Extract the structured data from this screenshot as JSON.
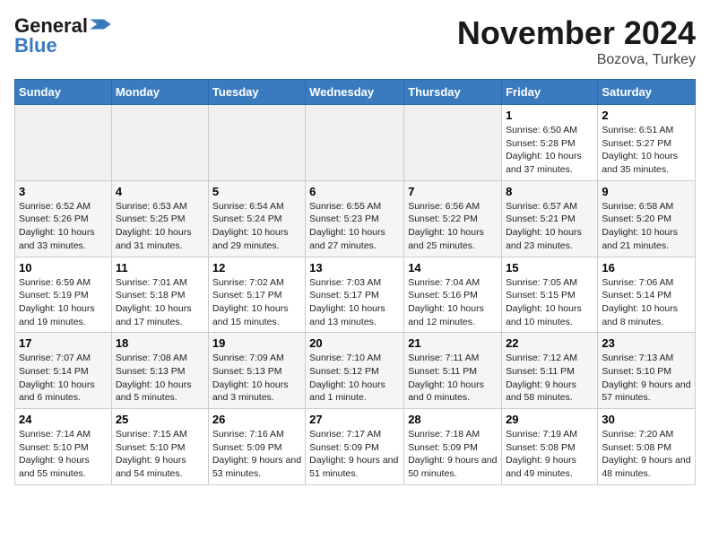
{
  "logo": {
    "line1": "General",
    "line2": "Blue"
  },
  "title": "November 2024",
  "location": "Bozova, Turkey",
  "days_of_week": [
    "Sunday",
    "Monday",
    "Tuesday",
    "Wednesday",
    "Thursday",
    "Friday",
    "Saturday"
  ],
  "weeks": [
    [
      {
        "num": "",
        "info": ""
      },
      {
        "num": "",
        "info": ""
      },
      {
        "num": "",
        "info": ""
      },
      {
        "num": "",
        "info": ""
      },
      {
        "num": "",
        "info": ""
      },
      {
        "num": "1",
        "info": "Sunrise: 6:50 AM\nSunset: 5:28 PM\nDaylight: 10 hours and 37 minutes."
      },
      {
        "num": "2",
        "info": "Sunrise: 6:51 AM\nSunset: 5:27 PM\nDaylight: 10 hours and 35 minutes."
      }
    ],
    [
      {
        "num": "3",
        "info": "Sunrise: 6:52 AM\nSunset: 5:26 PM\nDaylight: 10 hours and 33 minutes."
      },
      {
        "num": "4",
        "info": "Sunrise: 6:53 AM\nSunset: 5:25 PM\nDaylight: 10 hours and 31 minutes."
      },
      {
        "num": "5",
        "info": "Sunrise: 6:54 AM\nSunset: 5:24 PM\nDaylight: 10 hours and 29 minutes."
      },
      {
        "num": "6",
        "info": "Sunrise: 6:55 AM\nSunset: 5:23 PM\nDaylight: 10 hours and 27 minutes."
      },
      {
        "num": "7",
        "info": "Sunrise: 6:56 AM\nSunset: 5:22 PM\nDaylight: 10 hours and 25 minutes."
      },
      {
        "num": "8",
        "info": "Sunrise: 6:57 AM\nSunset: 5:21 PM\nDaylight: 10 hours and 23 minutes."
      },
      {
        "num": "9",
        "info": "Sunrise: 6:58 AM\nSunset: 5:20 PM\nDaylight: 10 hours and 21 minutes."
      }
    ],
    [
      {
        "num": "10",
        "info": "Sunrise: 6:59 AM\nSunset: 5:19 PM\nDaylight: 10 hours and 19 minutes."
      },
      {
        "num": "11",
        "info": "Sunrise: 7:01 AM\nSunset: 5:18 PM\nDaylight: 10 hours and 17 minutes."
      },
      {
        "num": "12",
        "info": "Sunrise: 7:02 AM\nSunset: 5:17 PM\nDaylight: 10 hours and 15 minutes."
      },
      {
        "num": "13",
        "info": "Sunrise: 7:03 AM\nSunset: 5:17 PM\nDaylight: 10 hours and 13 minutes."
      },
      {
        "num": "14",
        "info": "Sunrise: 7:04 AM\nSunset: 5:16 PM\nDaylight: 10 hours and 12 minutes."
      },
      {
        "num": "15",
        "info": "Sunrise: 7:05 AM\nSunset: 5:15 PM\nDaylight: 10 hours and 10 minutes."
      },
      {
        "num": "16",
        "info": "Sunrise: 7:06 AM\nSunset: 5:14 PM\nDaylight: 10 hours and 8 minutes."
      }
    ],
    [
      {
        "num": "17",
        "info": "Sunrise: 7:07 AM\nSunset: 5:14 PM\nDaylight: 10 hours and 6 minutes."
      },
      {
        "num": "18",
        "info": "Sunrise: 7:08 AM\nSunset: 5:13 PM\nDaylight: 10 hours and 5 minutes."
      },
      {
        "num": "19",
        "info": "Sunrise: 7:09 AM\nSunset: 5:13 PM\nDaylight: 10 hours and 3 minutes."
      },
      {
        "num": "20",
        "info": "Sunrise: 7:10 AM\nSunset: 5:12 PM\nDaylight: 10 hours and 1 minute."
      },
      {
        "num": "21",
        "info": "Sunrise: 7:11 AM\nSunset: 5:11 PM\nDaylight: 10 hours and 0 minutes."
      },
      {
        "num": "22",
        "info": "Sunrise: 7:12 AM\nSunset: 5:11 PM\nDaylight: 9 hours and 58 minutes."
      },
      {
        "num": "23",
        "info": "Sunrise: 7:13 AM\nSunset: 5:10 PM\nDaylight: 9 hours and 57 minutes."
      }
    ],
    [
      {
        "num": "24",
        "info": "Sunrise: 7:14 AM\nSunset: 5:10 PM\nDaylight: 9 hours and 55 minutes."
      },
      {
        "num": "25",
        "info": "Sunrise: 7:15 AM\nSunset: 5:10 PM\nDaylight: 9 hours and 54 minutes."
      },
      {
        "num": "26",
        "info": "Sunrise: 7:16 AM\nSunset: 5:09 PM\nDaylight: 9 hours and 53 minutes."
      },
      {
        "num": "27",
        "info": "Sunrise: 7:17 AM\nSunset: 5:09 PM\nDaylight: 9 hours and 51 minutes."
      },
      {
        "num": "28",
        "info": "Sunrise: 7:18 AM\nSunset: 5:09 PM\nDaylight: 9 hours and 50 minutes."
      },
      {
        "num": "29",
        "info": "Sunrise: 7:19 AM\nSunset: 5:08 PM\nDaylight: 9 hours and 49 minutes."
      },
      {
        "num": "30",
        "info": "Sunrise: 7:20 AM\nSunset: 5:08 PM\nDaylight: 9 hours and 48 minutes."
      }
    ]
  ]
}
